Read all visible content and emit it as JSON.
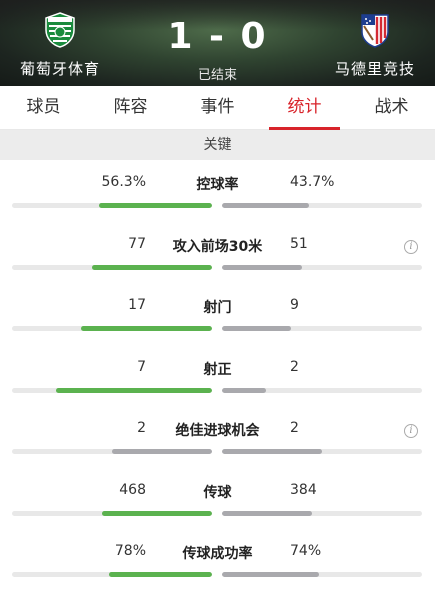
{
  "match": {
    "home_team": "葡萄牙体育",
    "away_team": "马德里竞技",
    "score": "1 - 0",
    "status": "已结束",
    "home_logo_icon": "sporting-cp-crest-icon",
    "away_logo_icon": "atletico-madrid-crest-icon"
  },
  "tabs": [
    {
      "label": "球员",
      "active": false
    },
    {
      "label": "阵容",
      "active": false
    },
    {
      "label": "事件",
      "active": false
    },
    {
      "label": "统计",
      "active": true
    },
    {
      "label": "战术",
      "active": false
    }
  ],
  "section_title": "关键",
  "colors": {
    "accent": "#d8232a",
    "home_bar": "#5bb24f",
    "away_bar": "#a9a9ad"
  },
  "stats": [
    {
      "label": "控球率",
      "home": "56.3%",
      "away": "43.7%",
      "home_share": 0.563,
      "away_share": 0.437,
      "home_leads": true,
      "info": false
    },
    {
      "label": "攻入前场30米",
      "home": "77",
      "away": "51",
      "home_share": 0.6,
      "away_share": 0.4,
      "home_leads": true,
      "info": true
    },
    {
      "label": "射门",
      "home": "17",
      "away": "9",
      "home_share": 0.654,
      "away_share": 0.346,
      "home_leads": true,
      "info": false
    },
    {
      "label": "射正",
      "home": "7",
      "away": "2",
      "home_share": 0.778,
      "away_share": 0.222,
      "home_leads": true,
      "info": false
    },
    {
      "label": "绝佳进球机会",
      "home": "2",
      "away": "2",
      "home_share": 0.5,
      "away_share": 0.5,
      "home_leads": false,
      "info": true
    },
    {
      "label": "传球",
      "home": "468",
      "away": "384",
      "home_share": 0.549,
      "away_share": 0.451,
      "home_leads": true,
      "info": false
    },
    {
      "label": "传球成功率",
      "home": "78%",
      "away": "74%",
      "home_share": 0.513,
      "away_share": 0.487,
      "home_leads": true,
      "info": false
    }
  ]
}
